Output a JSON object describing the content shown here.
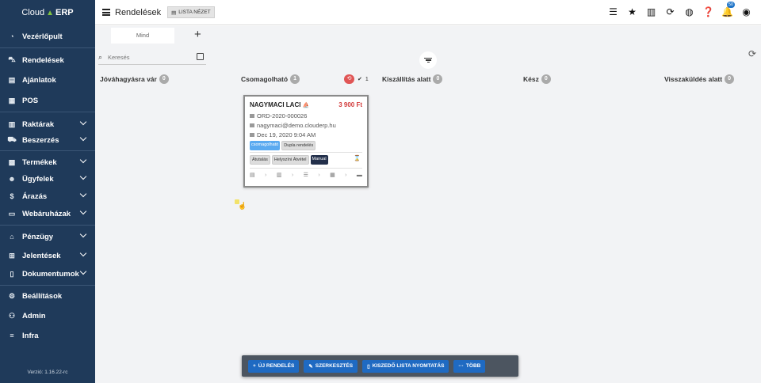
{
  "brand": {
    "name_light": "Cloud",
    "name_bold": "ERP"
  },
  "sidebar": {
    "items": [
      {
        "label": "Vezérlőpult",
        "icon": "dashboard-icon",
        "glyph": "◔"
      },
      {
        "label": "Rendelések",
        "icon": "cart-icon",
        "glyph": "🛒"
      },
      {
        "label": "Ajánlatok",
        "icon": "document-icon",
        "glyph": "▤"
      },
      {
        "label": "POS",
        "icon": "pos-icon",
        "glyph": "▦"
      },
      {
        "label": "Raktárak",
        "icon": "warehouse-icon",
        "glyph": "▥"
      },
      {
        "label": "Beszerzés",
        "icon": "truck-icon",
        "glyph": "⛟"
      },
      {
        "label": "Termékek",
        "icon": "products-icon",
        "glyph": "▩"
      },
      {
        "label": "Ügyfelek",
        "icon": "users-icon",
        "glyph": "👥"
      },
      {
        "label": "Árazás",
        "icon": "dollar-icon",
        "glyph": "$"
      },
      {
        "label": "Webáruházak",
        "icon": "store-icon",
        "glyph": "▭"
      },
      {
        "label": "Pénzügy",
        "icon": "bank-icon",
        "glyph": "⌂"
      },
      {
        "label": "Jelentések",
        "icon": "table-icon",
        "glyph": "⊞"
      },
      {
        "label": "Dokumentumok",
        "icon": "file-icon",
        "glyph": "▯"
      },
      {
        "label": "Beállítások",
        "icon": "gear-icon",
        "glyph": "⚙"
      },
      {
        "label": "Admin",
        "icon": "admin-icon",
        "glyph": "⚇"
      },
      {
        "label": "Infra",
        "icon": "list-icon",
        "glyph": "≡"
      }
    ],
    "version": "Verzió: 1.16.22-rc"
  },
  "topbar": {
    "title": "Rendelések",
    "list_view": "LISTA NÉZET",
    "notif_count": "50"
  },
  "tabs": {
    "all": "Mind",
    "add": "+"
  },
  "search": {
    "placeholder": "Keresés"
  },
  "columns": [
    {
      "title": "Jóváhagyásra vár",
      "count": "0"
    },
    {
      "title": "Csomagolható",
      "count": "1"
    },
    {
      "title": "Kiszállítás alatt",
      "count": "0"
    },
    {
      "title": "Kész",
      "count": "0"
    },
    {
      "title": "Visszaküldés alatt",
      "count": "0"
    }
  ],
  "col_extra": {
    "selected": "1"
  },
  "card": {
    "name": "NAGYMACI LACI",
    "price": "3 900 Ft",
    "order_no": "ORD-2020-000026",
    "email": "nagymaci@demo.clouderp.hu",
    "date": "Dec 19, 2020 9:04 AM",
    "tags": [
      "csomagolható",
      "Dupla rendelés"
    ],
    "tags2": [
      "Átutalás",
      "Helyszíni Átvétel",
      "Manual"
    ]
  },
  "bottom": {
    "new_order": "ÚJ RENDELÉS",
    "edit": "SZERKESZTÉS",
    "print": "KISZEDŐ LISTA NYOMTATÁS",
    "more": "TÖBB"
  }
}
